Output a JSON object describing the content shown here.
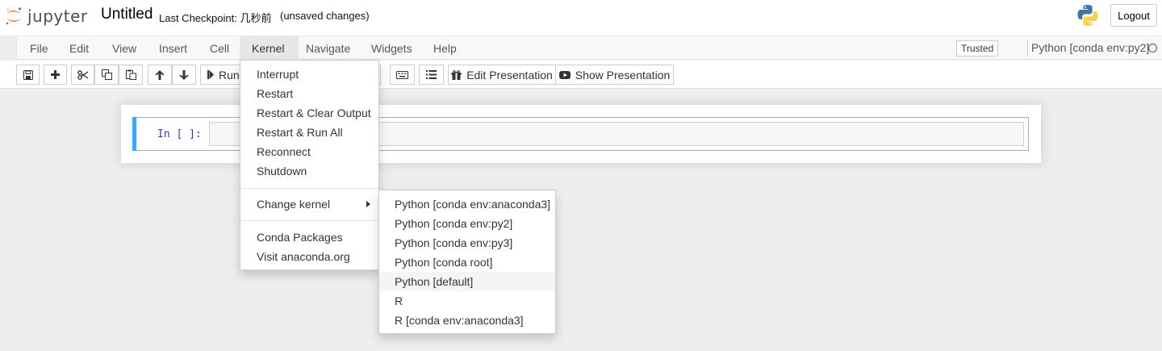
{
  "header": {
    "logo_text": "jupyter",
    "notebook_title": "Untitled",
    "checkpoint": "Last Checkpoint: 几秒前",
    "unsaved": "(unsaved changes)",
    "logout_label": "Logout"
  },
  "menubar": {
    "items": [
      {
        "label": "File"
      },
      {
        "label": "Edit"
      },
      {
        "label": "View"
      },
      {
        "label": "Insert"
      },
      {
        "label": "Cell"
      },
      {
        "label": "Kernel"
      },
      {
        "label": "Navigate"
      },
      {
        "label": "Widgets"
      },
      {
        "label": "Help"
      }
    ],
    "active": "Kernel",
    "trusted_label": "Trusted",
    "kernel_name": "Python [conda env:py2]"
  },
  "toolbar": {
    "run_label": "Run",
    "edit_presentation_label": "Edit Presentation",
    "show_presentation_label": "Show Presentation"
  },
  "cell": {
    "prompt": "In [ ]:"
  },
  "kernel_menu": {
    "items": [
      {
        "label": "Interrupt"
      },
      {
        "label": "Restart"
      },
      {
        "label": "Restart & Clear Output"
      },
      {
        "label": "Restart & Run All"
      },
      {
        "label": "Reconnect"
      },
      {
        "label": "Shutdown"
      },
      {
        "label": "Change kernel"
      },
      {
        "label": "Conda Packages"
      },
      {
        "label": "Visit anaconda.org"
      }
    ]
  },
  "change_kernel_submenu": {
    "items": [
      {
        "label": "Python [conda env:anaconda3]"
      },
      {
        "label": "Python [conda env:py2]"
      },
      {
        "label": "Python [conda env:py3]"
      },
      {
        "label": "Python [conda root]"
      },
      {
        "label": "Python [default]"
      },
      {
        "label": "R"
      },
      {
        "label": "R [conda env:anaconda3]"
      }
    ],
    "highlighted": "Python [default]"
  },
  "colors": {
    "cell_selected_bar": "#42a5f5",
    "prompt_in": "#303f9f",
    "jupyter_orange": "#f37726"
  }
}
